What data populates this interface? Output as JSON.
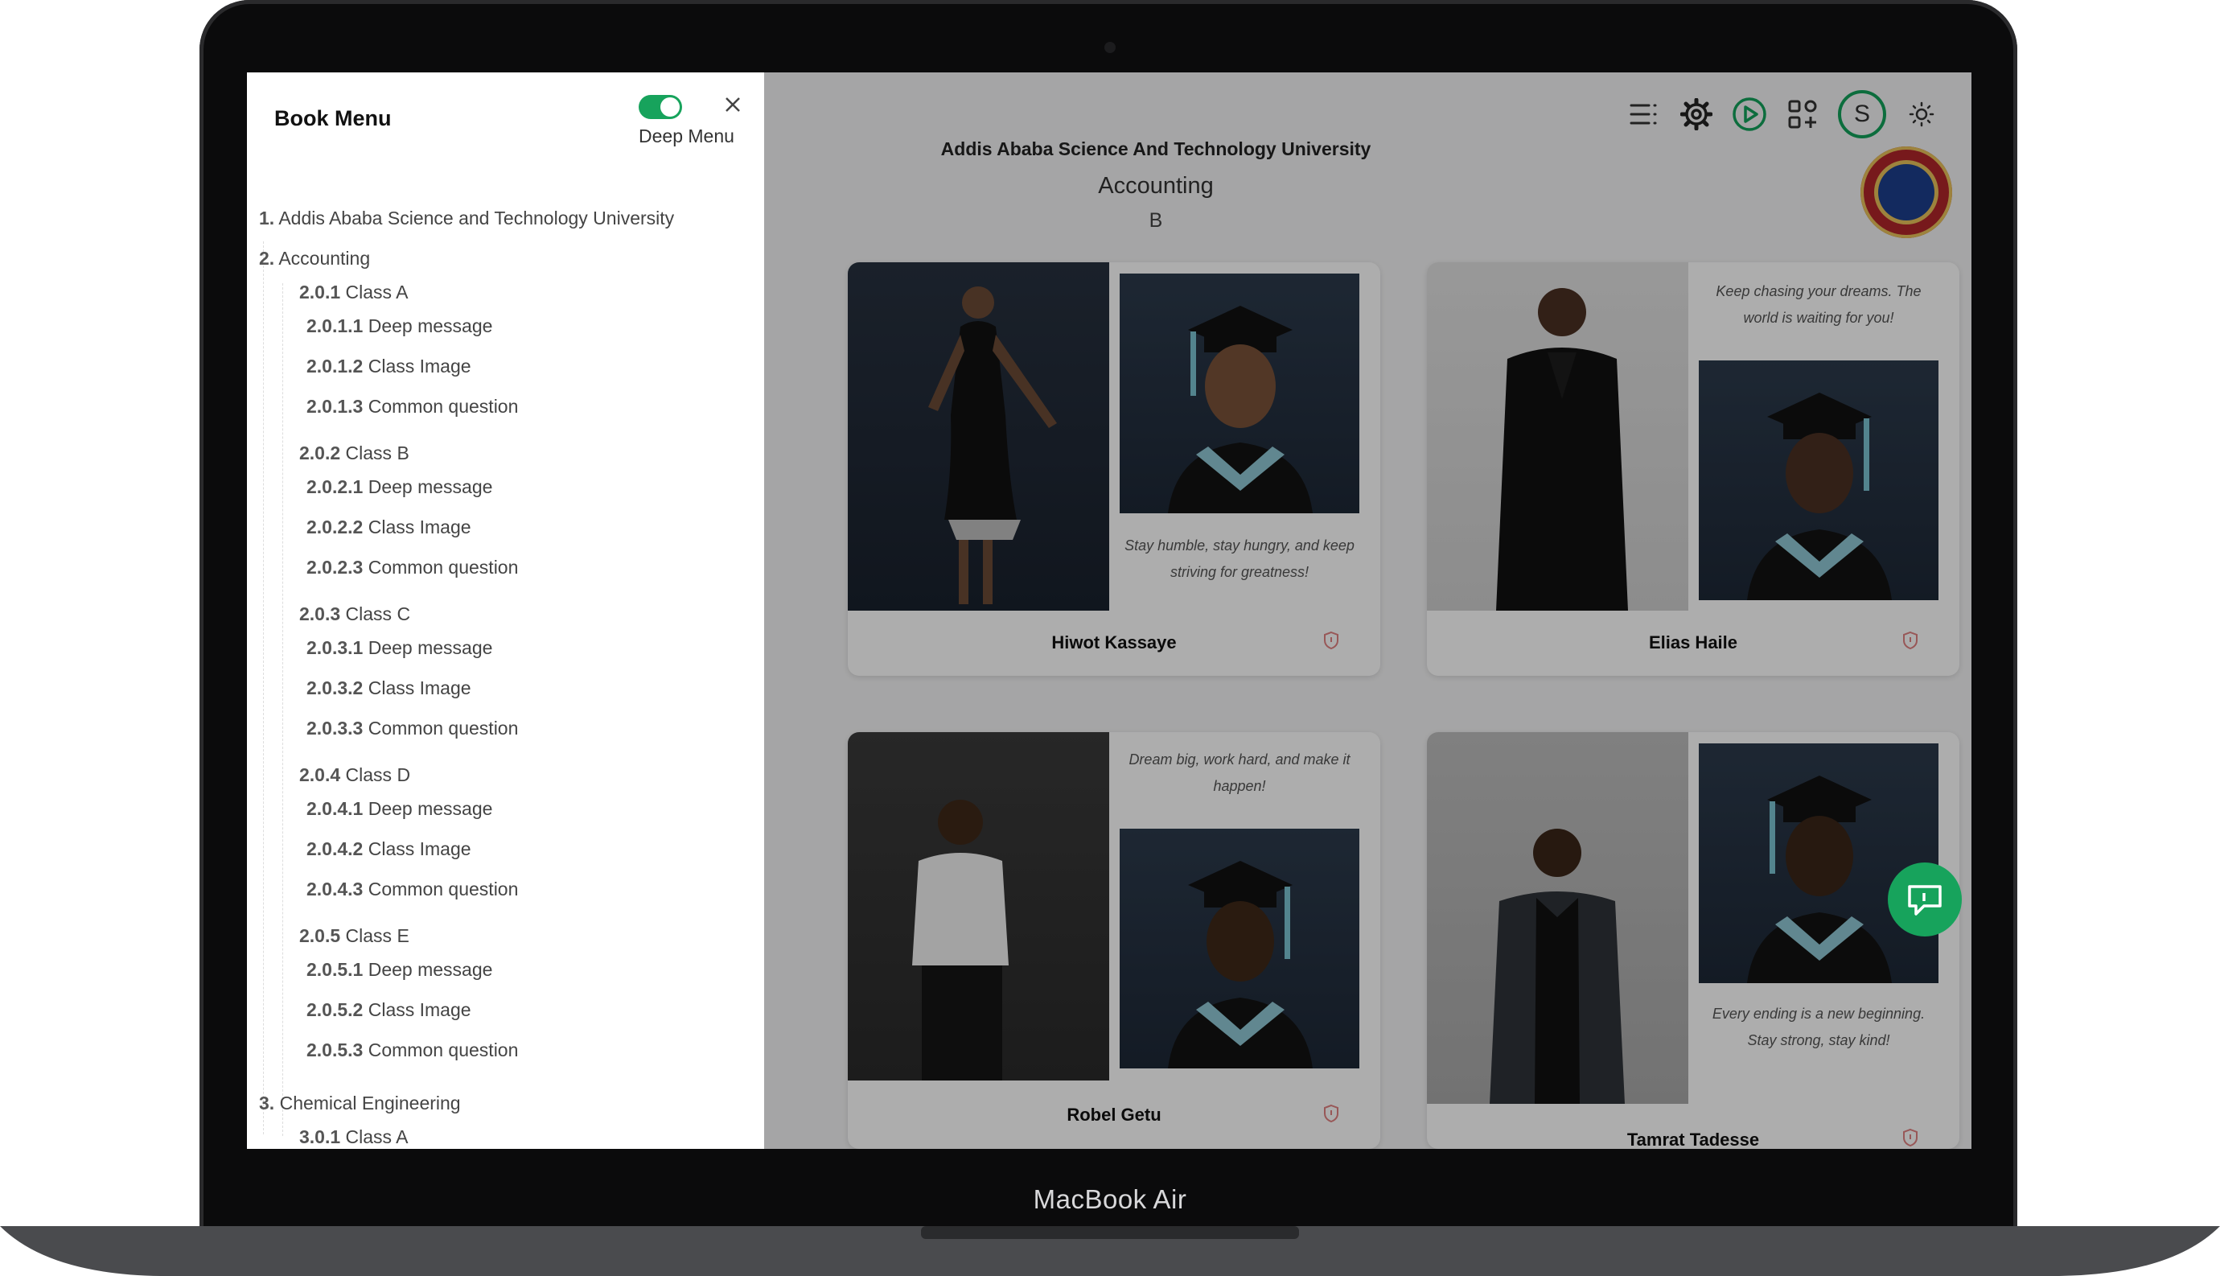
{
  "device": {
    "label": "MacBook Air"
  },
  "panel": {
    "title": "Book Menu",
    "toggle_label": "Deep Menu",
    "items": [
      {
        "num": "1.",
        "label": "Addis Ababa Science and Technology University"
      },
      {
        "num": "2.",
        "label": "Accounting"
      },
      {
        "num": "2.0.1",
        "label": "Class A"
      },
      {
        "num": "2.0.1.1",
        "label": "Deep message"
      },
      {
        "num": "2.0.1.2",
        "label": "Class Image"
      },
      {
        "num": "2.0.1.3",
        "label": "Common question"
      },
      {
        "num": "2.0.2",
        "label": "Class B"
      },
      {
        "num": "2.0.2.1",
        "label": "Deep message"
      },
      {
        "num": "2.0.2.2",
        "label": "Class Image"
      },
      {
        "num": "2.0.2.3",
        "label": "Common question"
      },
      {
        "num": "2.0.3",
        "label": "Class C"
      },
      {
        "num": "2.0.3.1",
        "label": "Deep message"
      },
      {
        "num": "2.0.3.2",
        "label": "Class Image"
      },
      {
        "num": "2.0.3.3",
        "label": "Common question"
      },
      {
        "num": "2.0.4",
        "label": "Class D"
      },
      {
        "num": "2.0.4.1",
        "label": "Deep message"
      },
      {
        "num": "2.0.4.2",
        "label": "Class Image"
      },
      {
        "num": "2.0.4.3",
        "label": "Common question"
      },
      {
        "num": "2.0.5",
        "label": "Class E"
      },
      {
        "num": "2.0.5.1",
        "label": "Deep message"
      },
      {
        "num": "2.0.5.2",
        "label": "Class Image"
      },
      {
        "num": "2.0.5.3",
        "label": "Common question"
      },
      {
        "num": "3.",
        "label": "Chemical Engineering"
      },
      {
        "num": "3.0.1",
        "label": "Class A"
      }
    ]
  },
  "main": {
    "university": "Addis Ababa Science And Technology University",
    "department": "Accounting",
    "class": "B",
    "cards": [
      {
        "name": "Hiwot Kassaye",
        "quote": "Stay humble, stay hungry, and keep striving for greatness!"
      },
      {
        "name": "Elias Haile",
        "quote": "Keep chasing your dreams. The world is waiting for you!"
      },
      {
        "name": "Robel Getu",
        "quote": "Dream big, work hard, and make it happen!"
      },
      {
        "name": "Tamrat Tadesse",
        "quote": "Every ending is a new beginning. Stay strong, stay kind!"
      }
    ],
    "partial_card_fragment": "t"
  },
  "toolbar": {
    "avatar_initial": "S",
    "icons": [
      "list-icon",
      "settings-gear-icon",
      "play-icon",
      "apps-grid-icon",
      "avatar",
      "sun-icon"
    ]
  },
  "colors": {
    "accent": "#17a35c",
    "overlay": "rgba(0,0,0,0.32)",
    "panel_bg": "#ffffff"
  }
}
